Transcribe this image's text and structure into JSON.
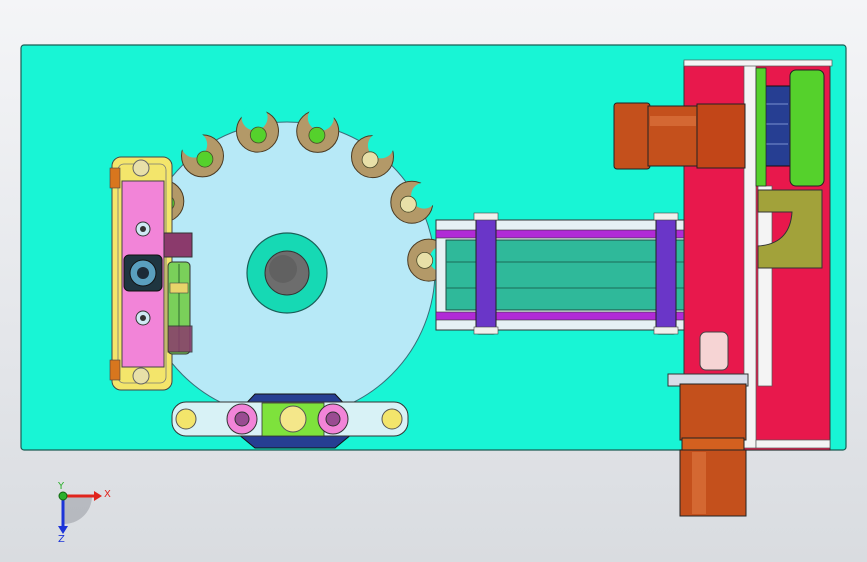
{
  "view": {
    "background": "#e6e8eb",
    "colors": {
      "base_plate": "#18f5d5",
      "dial": "#b7e9f7",
      "hub": "#16d9b4",
      "hole": "#6d6d6d",
      "pocket": "#b39968",
      "bottle": "#e8e0a8",
      "green_part": "#55d12c",
      "pink_block": "#f284d8",
      "yellow_rail": "#f3e56b",
      "purple_clamp": "#6a36c8",
      "teal_belt": "#2fb99a",
      "crimson_frame": "#e8184c",
      "motor_orange": "#c4501c",
      "olive_bracket": "#a2a23a",
      "navy_roller": "#263e92"
    },
    "icons": [
      "coordinate-triad-icon"
    ]
  },
  "triad": {
    "x_label": "X",
    "y_label": "Y",
    "z_label": "Z",
    "x_color": "#e0241c",
    "y_color": "#2cb02c",
    "z_color": "#1c34d8"
  }
}
